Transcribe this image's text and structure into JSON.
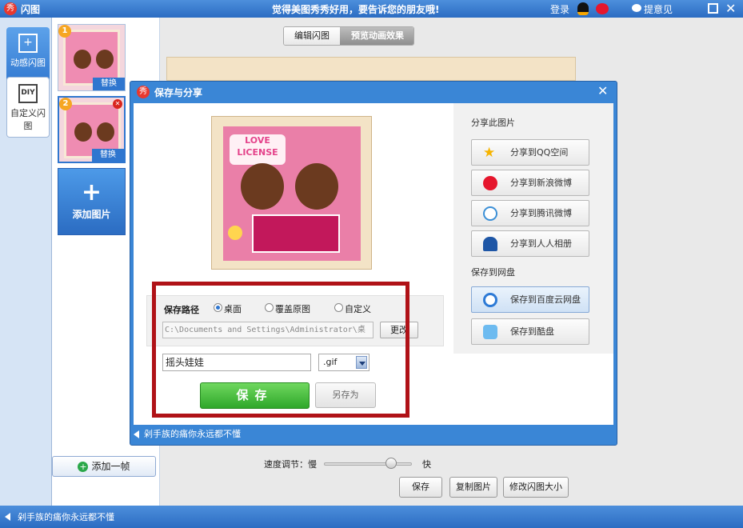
{
  "titlebar": {
    "logo_glyph": "秀",
    "title": "闪图",
    "slogan": "觉得美图秀秀好用，要告诉您的朋友哦!",
    "login": "登录",
    "feedback": "提意见"
  },
  "left_tabs": {
    "animated": "动感闪图",
    "custom": "自定义闪图",
    "custom_icon_text": "DIY"
  },
  "thumbs": {
    "one_number": "1",
    "two_number": "2",
    "replace_label": "替换",
    "thumb_text": "LOVE LICENSE"
  },
  "add_image": {
    "plus": "+",
    "label": "添加图片"
  },
  "add_frame": {
    "label": "添加一帧"
  },
  "main": {
    "tab_edit": "编辑闪图",
    "tab_preview": "预览动画效果",
    "speed_label": "速度调节：慢",
    "speed_fast": "快",
    "save": "保存",
    "copy": "复制图片",
    "resize": "修改闪图大小"
  },
  "status": {
    "text": "剁手族的痛你永远都不懂"
  },
  "dialog": {
    "title": "保存与分享",
    "preview_banner": "LOVE LICENSE",
    "save_path_label": "保存路径",
    "opt_desktop": "桌面",
    "opt_overwrite": "覆盖原图",
    "opt_custom": "自定义",
    "path_value": "C:\\Documents and Settings\\Administrator\\桌",
    "change_button": "更改",
    "file_name": "摇头娃娃",
    "format": ".gif",
    "save_button": "保存",
    "save_as_button": "另存为",
    "share_heading": "分享此图片",
    "share_qzone": "分享到QQ空间",
    "share_sina": "分享到新浪微博",
    "share_tencent": "分享到腾讯微博",
    "share_renren": "分享到人人相册",
    "cloud_heading": "保存到网盘",
    "cloud_baidu": "保存到百度云网盘",
    "cloud_kupan": "保存到酷盘",
    "footer": "剁手族的痛你永远都不懂"
  },
  "colors": {
    "accent": "#2f76cf",
    "highlight_box": "#b01217",
    "save_green": "#2fa72a"
  }
}
